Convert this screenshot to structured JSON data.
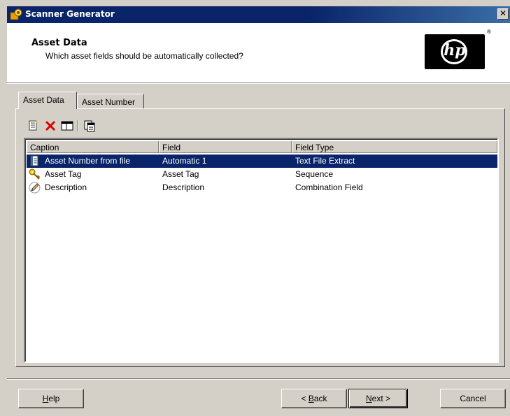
{
  "window": {
    "title": "Scanner Generator"
  },
  "header": {
    "title": "Asset Data",
    "subtitle": "Which asset fields should be automatically collected?",
    "logo_text": "hp",
    "registered": "®"
  },
  "tabs": [
    {
      "label": "Asset Data",
      "active": true
    },
    {
      "label": "Asset Number",
      "active": false
    }
  ],
  "toolbar": {
    "buttons": [
      {
        "icon": "new-field-icon"
      },
      {
        "icon": "delete-icon"
      },
      {
        "icon": "properties-icon"
      },
      {
        "icon": "copy-icon"
      }
    ]
  },
  "list": {
    "columns": [
      "Caption",
      "Field",
      "Field Type"
    ],
    "rows": [
      {
        "icon": "text-file-icon",
        "caption": "Asset Number from file",
        "field": "Automatic 1",
        "type": "Text File Extract",
        "selected": true
      },
      {
        "icon": "key-icon",
        "caption": "Asset Tag",
        "field": "Asset Tag",
        "type": "Sequence",
        "selected": false
      },
      {
        "icon": "pencil-icon",
        "caption": "Description",
        "field": "Description",
        "type": "Combination Field",
        "selected": false
      }
    ]
  },
  "buttons": {
    "help": {
      "prefix": "",
      "hotkey": "H",
      "rest": "elp"
    },
    "back": {
      "prefix": "< ",
      "hotkey": "B",
      "rest": "ack"
    },
    "next": {
      "prefix": "",
      "hotkey": "N",
      "rest": "ext >"
    },
    "cancel": "Cancel"
  },
  "colors": {
    "selection": "#0a246a",
    "titlebar": "#0a246a",
    "face": "#d4d0c8"
  }
}
